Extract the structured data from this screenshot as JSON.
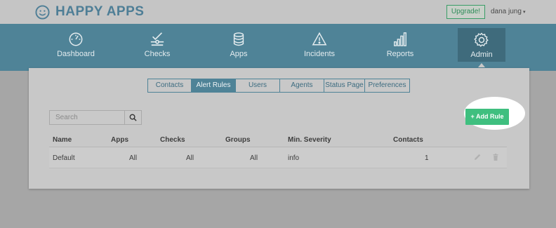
{
  "header": {
    "logo_text": "HAPPY APPS",
    "upgrade_label": "Upgrade!",
    "user_name": "dana jung",
    "user_caret": "▾"
  },
  "nav": {
    "items": [
      {
        "label": "Dashboard",
        "icon": "gauge-icon"
      },
      {
        "label": "Checks",
        "icon": "checks-icon"
      },
      {
        "label": "Apps",
        "icon": "database-icon"
      },
      {
        "label": "Incidents",
        "icon": "warning-icon"
      },
      {
        "label": "Reports",
        "icon": "bar-chart-icon"
      },
      {
        "label": "Admin",
        "icon": "gear-icon",
        "active": true
      }
    ]
  },
  "tabs": [
    {
      "label": "Contacts"
    },
    {
      "label": "Alert Rules",
      "active": true
    },
    {
      "label": "Users"
    },
    {
      "label": "Agents"
    },
    {
      "label": "Status Page"
    },
    {
      "label": "Preferences"
    }
  ],
  "search": {
    "placeholder": "Search"
  },
  "add_button_label": "+ Add Rule",
  "table": {
    "columns": [
      "Name",
      "Apps",
      "Checks",
      "Groups",
      "Min. Severity",
      "Contacts"
    ],
    "rows": [
      {
        "name": "Default",
        "apps": "All",
        "checks": "All",
        "groups": "All",
        "min_severity": "info",
        "contacts": "1"
      }
    ]
  },
  "colors": {
    "brand": "#4f8397",
    "accent_green": "#3fbf7f",
    "background": "#a6a6a6"
  }
}
